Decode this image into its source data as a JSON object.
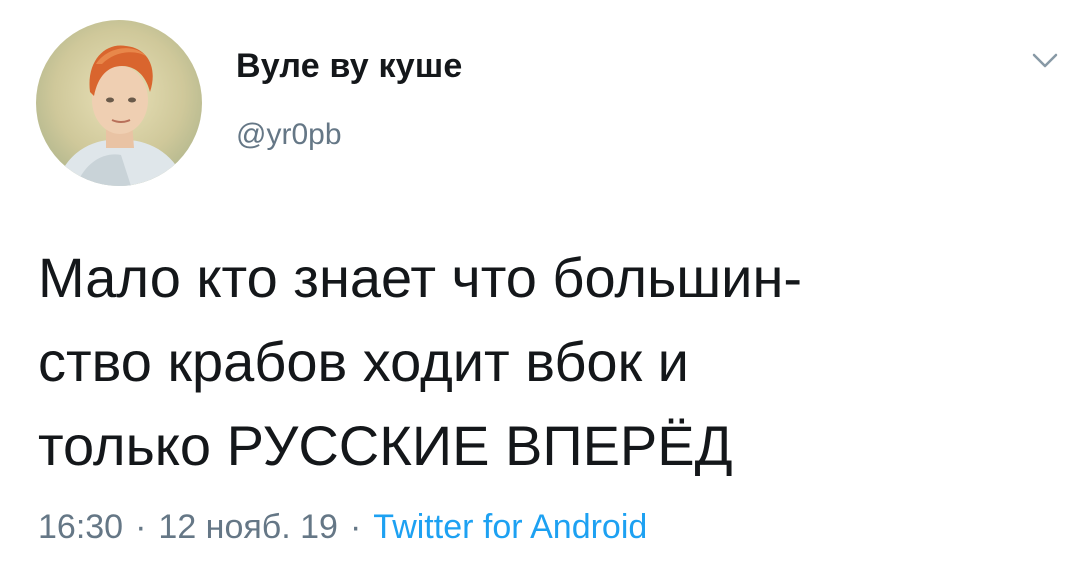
{
  "author": {
    "display_name": "Вуле ву куше",
    "handle": "@yr0pb",
    "avatar_icon": "portrait-painting-avatar"
  },
  "menu_icon": "chevron-down-icon",
  "tweet": {
    "lines": [
      "Мало кто знает что большин-",
      "ство крабов ходит вбок и",
      "только РУССКИЕ ВПЕРЁД"
    ]
  },
  "meta": {
    "time": "16:30",
    "separator": "·",
    "date": "12 нояб. 19",
    "source": "Twitter for Android"
  },
  "colors": {
    "text": "#14171a",
    "secondary": "#657786",
    "link": "#1da1f2"
  }
}
